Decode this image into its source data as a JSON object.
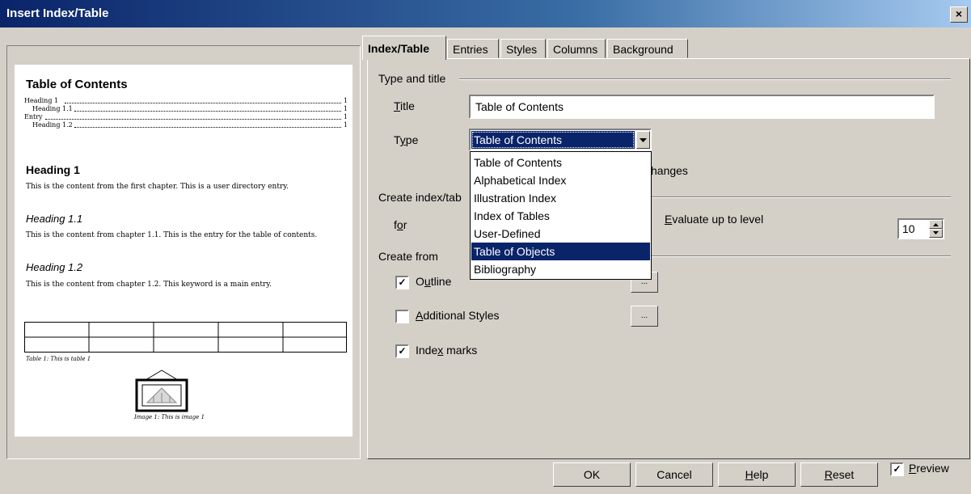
{
  "window": {
    "title": "Insert Index/Table",
    "close_glyph": "×"
  },
  "preview": {
    "toc_title": "Table of Contents",
    "toc_lines": [
      {
        "text": "Heading 1",
        "page": "1"
      },
      {
        "text": "Heading 1.1",
        "page": "1"
      },
      {
        "text": "Entry",
        "page": "1"
      },
      {
        "text": "Heading 1.2",
        "page": "1"
      }
    ],
    "heading1": "Heading 1",
    "heading1_body": "This is the content from the first chapter. This is a user directory entry.",
    "heading11": "Heading 1.1",
    "heading11_body": "This is the content from chapter 1.1. This is the entry for the table of contents.",
    "heading12": "Heading 1.2",
    "heading12_body": "This is the content from chapter 1.2. This keyword is a main entry.",
    "table_caption": "Table 1: This is table 1",
    "image_caption": "Image 1: This is image 1"
  },
  "tabs": [
    {
      "label": "Index/Table",
      "active": true
    },
    {
      "label": "Entries",
      "active": false
    },
    {
      "label": "Styles",
      "active": false
    },
    {
      "label": "Columns",
      "active": false
    },
    {
      "label": "Background",
      "active": false
    }
  ],
  "type_and_title": {
    "group_label": "Type and title",
    "title_label": "Title",
    "title_value": "Table of Contents",
    "type_label": "Type",
    "type_value": "Table of Contents",
    "type_options": [
      "Table of Contents",
      "Alphabetical Index",
      "Illustration Index",
      "Index of Tables",
      "User-Defined",
      "Table of Objects",
      "Bibliography"
    ],
    "highlighted_option": "Table of Objects",
    "protected_label_fragment": "hanges"
  },
  "create_index": {
    "group_label": "Create index/tab",
    "for_label": "for",
    "evaluate_label": "Evaluate up to level",
    "level_value": "10"
  },
  "create_from": {
    "group_label": "Create from",
    "outline_label": "Outline",
    "outline_checked": true,
    "outline_button": "...",
    "additional_styles_label": "Additional Styles",
    "additional_styles_checked": false,
    "additional_styles_button": "...",
    "index_marks_label": "Index marks",
    "index_marks_checked": true
  },
  "footer": {
    "ok": "OK",
    "cancel": "Cancel",
    "help": "Help",
    "reset": "Reset",
    "preview_label": "Preview",
    "preview_checked": true
  }
}
